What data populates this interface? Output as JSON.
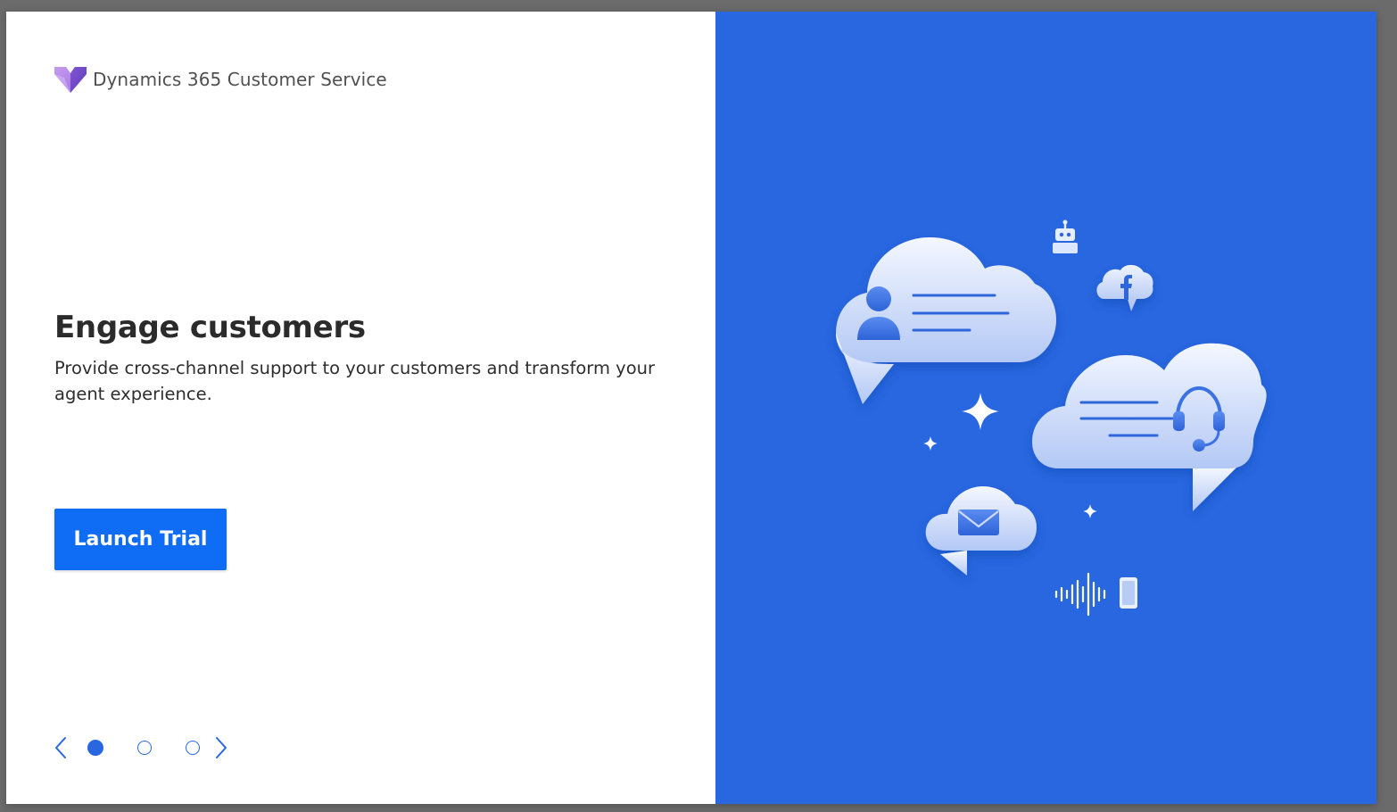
{
  "brand": {
    "name": "Dynamics 365 Customer Service",
    "logo_icon": "dynamics-heart-logo-icon"
  },
  "slide": {
    "title": "Engage customers",
    "description": "Provide cross-channel support to your customers and transform your agent experience."
  },
  "actions": {
    "launch_label": "Launch Trial"
  },
  "pager": {
    "total_slides": 3,
    "active_index": 0,
    "prev_icon": "chevron-left-icon",
    "next_icon": "chevron-right-icon"
  },
  "colors": {
    "accent": "#0f6cf5",
    "panel_blue": "#2867e0",
    "logo_purple": "#8b5fd6",
    "logo_violet": "#b489e8"
  },
  "illustration": {
    "icons": [
      "person-chat-cloud-icon",
      "agent-headset-cloud-icon",
      "email-cloud-icon",
      "facebook-cloud-icon",
      "bot-icon",
      "voice-wave-icon",
      "phone-icon",
      "sparkle-icon"
    ]
  }
}
